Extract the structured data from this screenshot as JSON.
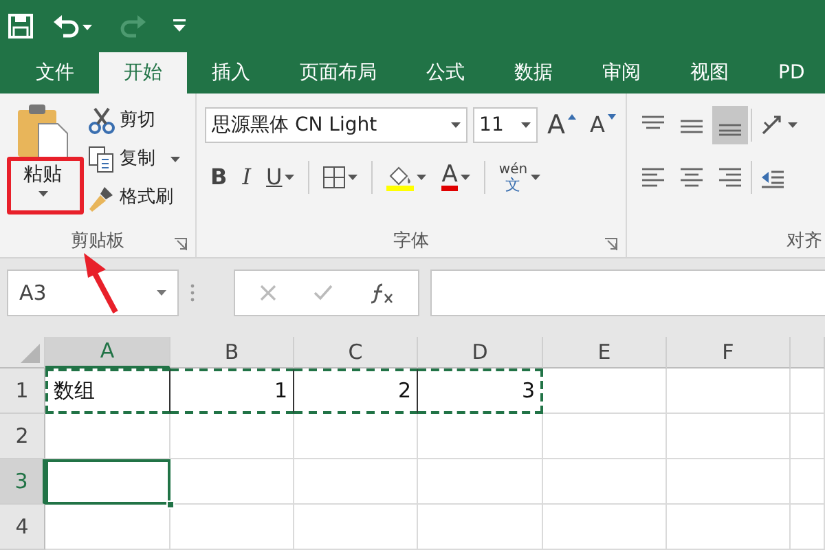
{
  "quick_access": [
    {
      "kind": "save",
      "disabled": false
    },
    {
      "kind": "undo",
      "disabled": false
    },
    {
      "kind": "redo",
      "disabled": true
    },
    {
      "kind": "customize",
      "disabled": false
    }
  ],
  "tabs": [
    {
      "label": "文件",
      "selected": false
    },
    {
      "label": "开始",
      "selected": true
    },
    {
      "label": "插入",
      "selected": false
    },
    {
      "label": "页面布局",
      "selected": false
    },
    {
      "label": "公式",
      "selected": false
    },
    {
      "label": "数据",
      "selected": false
    },
    {
      "label": "审阅",
      "selected": false
    },
    {
      "label": "视图",
      "selected": false
    },
    {
      "label": "PD",
      "selected": false
    }
  ],
  "clipboard": {
    "label": "剪贴板",
    "paste": "粘贴",
    "tools": [
      {
        "label": "剪切",
        "dropdown": false
      },
      {
        "label": "复制",
        "dropdown": true
      },
      {
        "label": "格式刷",
        "dropdown": false
      }
    ]
  },
  "font": {
    "label": "字体",
    "font_name": "思源黑体 CN Light",
    "font_size": "11",
    "grow": "A",
    "shrink": "A",
    "bold": "B",
    "italic": "I",
    "underline": "U",
    "font_color": "A",
    "phonetic_top": "wén",
    "phonetic_bottom": "文"
  },
  "alignment": {
    "label": "对齐"
  },
  "formula_bar": {
    "name_box": "A3"
  },
  "columns": [
    {
      "label": "A",
      "selected": true
    },
    {
      "label": "B",
      "selected": false
    },
    {
      "label": "C",
      "selected": false
    },
    {
      "label": "D",
      "selected": false
    },
    {
      "label": "E",
      "selected": false
    },
    {
      "label": "F",
      "selected": false
    }
  ],
  "rows": [
    {
      "header": "1",
      "selected": false,
      "cells": [
        {
          "kind": "text",
          "text": "数组",
          "copied": true,
          "selected": false
        },
        {
          "kind": "number",
          "text": "1",
          "copied": true,
          "selected": false
        },
        {
          "kind": "number",
          "text": "2",
          "copied": true,
          "selected": false
        },
        {
          "kind": "number",
          "text": "3",
          "copied": true,
          "selected": false
        },
        {
          "kind": "empty",
          "copied": false,
          "selected": false
        },
        {
          "kind": "empty",
          "copied": false,
          "selected": false
        }
      ]
    },
    {
      "header": "2",
      "selected": false,
      "cells": [
        {
          "kind": "empty",
          "copied": false,
          "selected": false
        },
        {
          "kind": "empty",
          "copied": false,
          "selected": false
        },
        {
          "kind": "empty",
          "copied": false,
          "selected": false
        },
        {
          "kind": "empty",
          "copied": false,
          "selected": false
        },
        {
          "kind": "empty",
          "copied": false,
          "selected": false
        },
        {
          "kind": "empty",
          "copied": false,
          "selected": false
        }
      ]
    },
    {
      "header": "3",
      "selected": true,
      "cells": [
        {
          "kind": "empty",
          "copied": false,
          "selected": true
        },
        {
          "kind": "empty",
          "copied": false,
          "selected": false
        },
        {
          "kind": "empty",
          "copied": false,
          "selected": false
        },
        {
          "kind": "empty",
          "copied": false,
          "selected": false
        },
        {
          "kind": "empty",
          "copied": false,
          "selected": false
        },
        {
          "kind": "empty",
          "copied": false,
          "selected": false
        }
      ]
    },
    {
      "header": "4",
      "selected": false,
      "cells": [
        {
          "kind": "empty",
          "copied": false,
          "selected": false
        },
        {
          "kind": "empty",
          "copied": false,
          "selected": false
        },
        {
          "kind": "empty",
          "copied": false,
          "selected": false
        },
        {
          "kind": "empty",
          "copied": false,
          "selected": false
        },
        {
          "kind": "empty",
          "copied": false,
          "selected": false
        },
        {
          "kind": "empty",
          "copied": false,
          "selected": false
        }
      ]
    }
  ]
}
